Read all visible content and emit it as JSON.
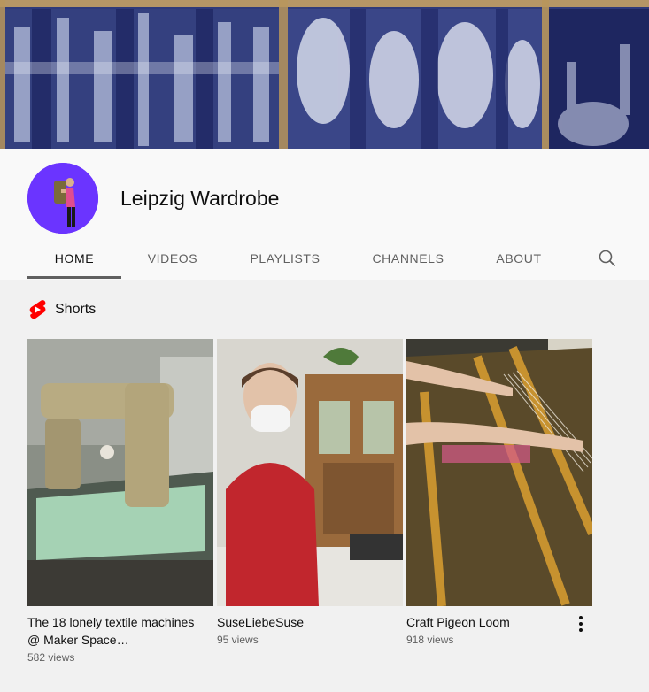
{
  "channel": {
    "name": "Leipzig Wardrobe",
    "avatar_color": "#6b34ff",
    "banner_accent": "#2f3a7a"
  },
  "tabs": [
    {
      "label": "HOME",
      "active": true
    },
    {
      "label": "VIDEOS",
      "active": false
    },
    {
      "label": "PLAYLISTS",
      "active": false
    },
    {
      "label": "CHANNELS",
      "active": false
    },
    {
      "label": "ABOUT",
      "active": false
    }
  ],
  "search": {
    "icon": "search-icon"
  },
  "shorts": {
    "section_title": "Shorts",
    "icon": "shorts-logo-icon",
    "brand_color": "#ff0000",
    "items": [
      {
        "title": "The 18 lonely textile machines @ Maker Space…",
        "views": "582 views"
      },
      {
        "title": "SuseLiebeSuse",
        "views": "95 views"
      },
      {
        "title": "Craft Pigeon Loom",
        "views": "918 views"
      }
    ],
    "more_icon": "more-vert-icon"
  }
}
